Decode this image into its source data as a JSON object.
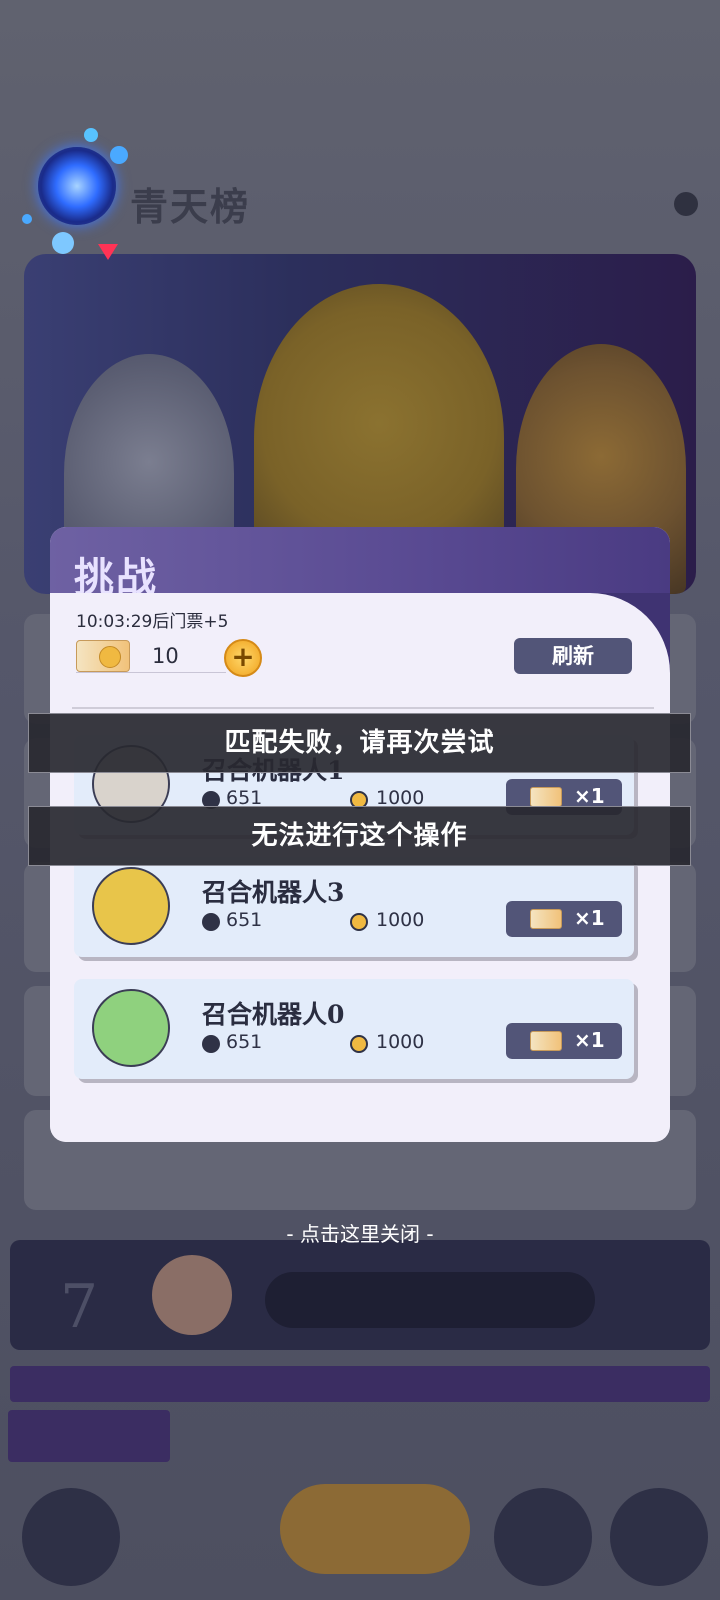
{
  "background": {
    "leaderboard_title": "青天榜",
    "my_rank": "7"
  },
  "modal": {
    "title": "挑战",
    "timer_text": "10:03:29后门票+5",
    "ticket_count": "10",
    "plus_symbol": "+",
    "refresh_label": "刷新",
    "cards": [
      {
        "name": "召合机器人1",
        "power": "651",
        "coins": "1000",
        "cost": "×1",
        "avatar_color": "#d9d3cc"
      },
      {
        "name": "召合机器人3",
        "power": "651",
        "coins": "1000",
        "cost": "×1",
        "avatar_color": "#e8c54a"
      },
      {
        "name": "召合机器人0",
        "power": "651",
        "coins": "1000",
        "cost": "×1",
        "avatar_color": "#8fd17e"
      }
    ]
  },
  "toasts": {
    "match_failed": "匹配失败，请再次尝试",
    "cannot_perform": "无法进行这个操作"
  },
  "close_hint": "- 点击这里关闭 -",
  "colors": {
    "modal_header": "#594a92",
    "button_bg": "#525578",
    "card_bg": "#e3ecfa",
    "ticket_gold": "#f0b941"
  }
}
